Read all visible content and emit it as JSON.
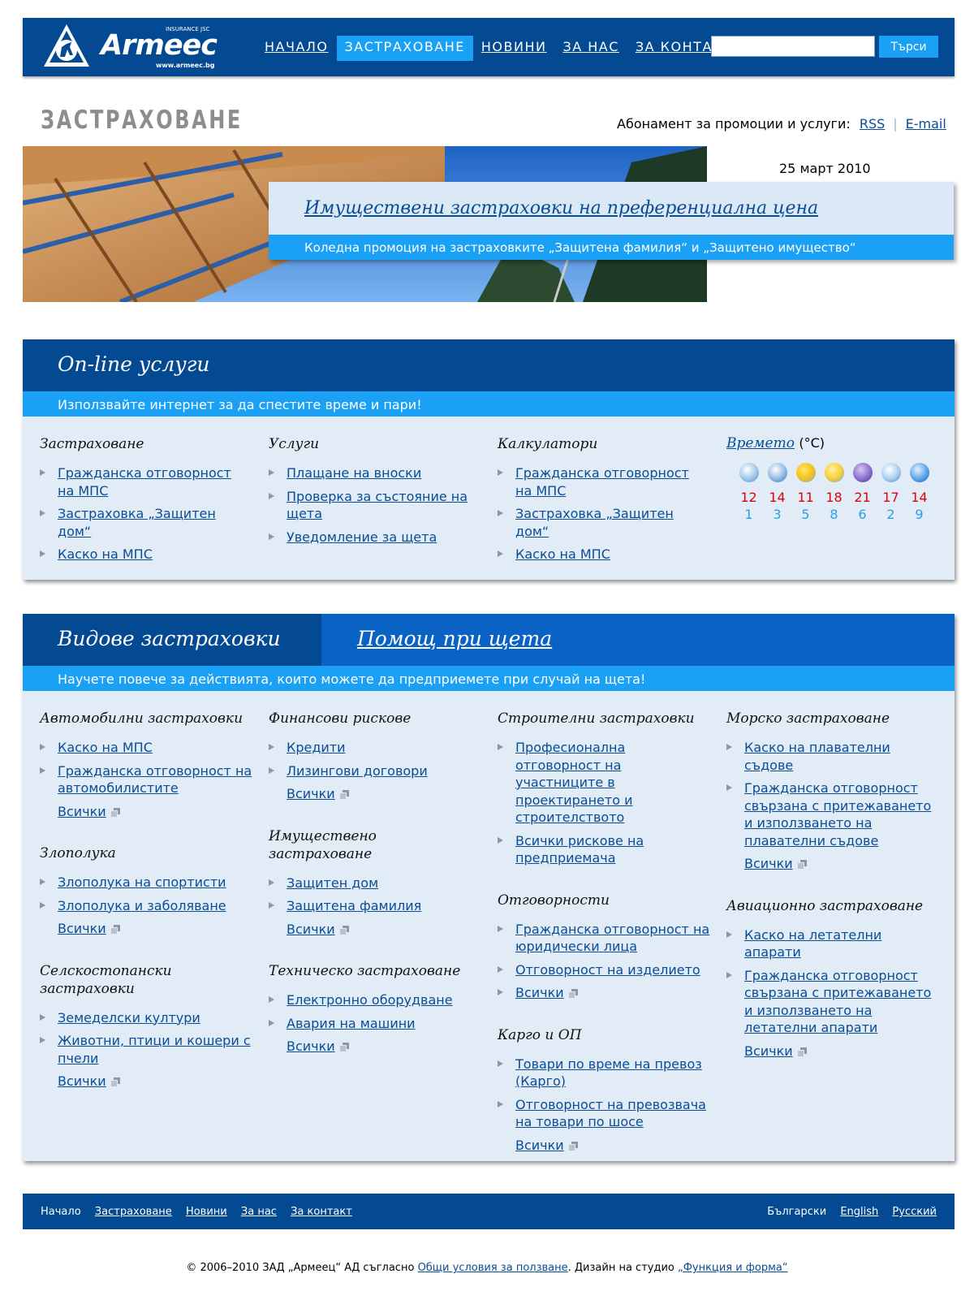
{
  "header": {
    "logo": {
      "brand": "Armeec",
      "tagline": "INSURANCE JSC",
      "url": "www.armeec.bg"
    },
    "nav": [
      {
        "label": "НАЧАЛО",
        "active": false
      },
      {
        "label": "ЗАСТРАХОВАНЕ",
        "active": true
      },
      {
        "label": "НОВИНИ",
        "active": false
      },
      {
        "label": "ЗА НАС",
        "active": false
      },
      {
        "label": "ЗА КОНТАКТ",
        "active": false
      }
    ],
    "search": {
      "value": "",
      "button": "Търси"
    }
  },
  "page": {
    "title": "ЗАСТРАХОВАНЕ",
    "subscribe_label": "Абонамент за промоции и услуги:",
    "subscribe_rss": "RSS",
    "subscribe_email": "E-mail",
    "date": "25 март 2010"
  },
  "promo": {
    "title": "Имуществени застраховки на преференциална цена",
    "subtitle": "Коледна промоция на застраховките „Защитена фамилия“ и „Защитено имущество“"
  },
  "online": {
    "heading": "On-line услуги",
    "subheading": "Използвайте интернет за да спестите време и пари!",
    "columns": [
      {
        "title": "Застраховане",
        "links": [
          "Гражданска отговорност на МПС",
          "Застраховка „Защитен дом“",
          "Каско на МПС"
        ]
      },
      {
        "title": "Услуги",
        "links": [
          "Плащане на вноски",
          "Проверка за състояние на щета",
          "Уведомление за щета"
        ]
      },
      {
        "title": "Калкулатори",
        "links": [
          "Гражданска отговорност на МПС",
          "Застраховка „Защитен дом“",
          "Каско на МПС"
        ]
      }
    ],
    "weather": {
      "link": "Времето",
      "unit": "(°C)",
      "icons": [
        "snow-cloud-icon",
        "rain-cloud-icon",
        "sun-cloud-icon",
        "sun-rain-icon",
        "thunderstorm-icon",
        "snow-cloud-icon",
        "snowflake-icon"
      ],
      "highs": [
        "12",
        "14",
        "11",
        "18",
        "21",
        "17",
        "14"
      ],
      "lows": [
        "1",
        "3",
        "5",
        "8",
        "6",
        "2",
        "9"
      ]
    }
  },
  "types": {
    "tab_active": "Видове застраховки",
    "tab_inactive": "Помощ при щета",
    "subheading": "Научете повече за действията, които можете да предприемете при случай на щета!",
    "all_label": "Всички",
    "columns": [
      [
        {
          "title": "Автомобилни застраховки",
          "links": [
            "Каско на МПС",
            "Гражданска отговорност на автомобилистите"
          ]
        },
        {
          "title": "Злополука",
          "links": [
            "Злополука на спортисти",
            "Злополука и заболяване"
          ]
        },
        {
          "title": "Селскостопански застраховки",
          "links": [
            "Земеделски култури",
            "Животни, птици и кошери с пчели"
          ]
        }
      ],
      [
        {
          "title": "Финансови рискове",
          "links": [
            "Кредити",
            "Лизингови договори"
          ]
        },
        {
          "title": "Имуществено застраховане",
          "links": [
            "Защитен дом",
            "Защитена фамилия"
          ]
        },
        {
          "title": "Техническо застраховане",
          "links": [
            "Електронно оборудване",
            "Авария на машини"
          ]
        }
      ],
      [
        {
          "title": "Строителни застраховки",
          "links": [
            "Професионална отговорност на участниците в проектирането и строителството",
            "Всички рискове на предприемача"
          ],
          "no_all": true
        },
        {
          "title": "Отговорности",
          "links": [
            "Гражданска отговорност на юридически лица",
            "Отговорност на изделието"
          ]
        },
        {
          "title": "Карго и ОП",
          "links": [
            "Товари по време на превоз (Карго)",
            "Отговорност на превозвача на товари по шосе"
          ]
        }
      ],
      [
        {
          "title": "Морско застраховане",
          "links": [
            "Каско на плавателни съдове",
            "Гражданска отговорност свързана с притежаването и използването на плавателни съдове"
          ]
        },
        {
          "title": "Авиационно застраховане",
          "links": [
            "Каско на летателни апарати",
            "Гражданска отговорност свързана с притежаването и използването на летателни апарати"
          ]
        }
      ]
    ]
  },
  "footer": {
    "nav": [
      {
        "label": "Начало",
        "link": false
      },
      {
        "label": "Застраховане",
        "link": true
      },
      {
        "label": "Новини",
        "link": true
      },
      {
        "label": "За нас",
        "link": true
      },
      {
        "label": "За контакт",
        "link": true
      }
    ],
    "languages": [
      {
        "label": "Български",
        "link": false
      },
      {
        "label": "English",
        "link": true
      },
      {
        "label": "Русский",
        "link": true
      }
    ],
    "copyright_prefix": "© 2006–2010 ЗАД „Армеец“ АД съгласно",
    "terms_link": "Общи условия за ползване",
    "design_prefix": ".  Дизайн на студио",
    "studio_link": "„Функция и форма“"
  },
  "colors": {
    "navy": "#034a93",
    "bright_blue": "#1aa0f5",
    "panel_bg": "#e1ecf7",
    "link": "#0a4d95",
    "temp_high": "#e2000d",
    "temp_low": "#2b9fe6"
  }
}
